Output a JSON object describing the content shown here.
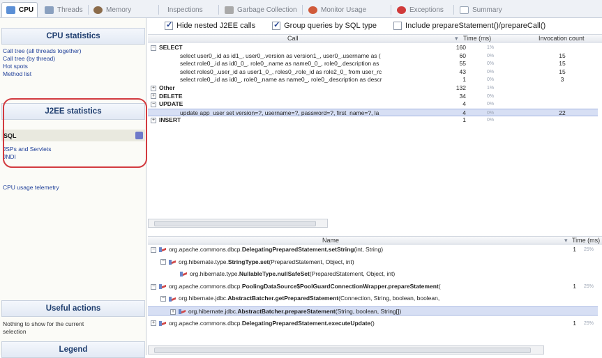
{
  "tabs": [
    {
      "label": "CPU",
      "active": true,
      "icon": "cpu-icon",
      "color": "#5b8fd6"
    },
    {
      "label": "Threads",
      "active": false,
      "icon": "threads-icon",
      "color": "#8aa0bf"
    },
    {
      "label": "Memory",
      "active": false,
      "icon": "memory-icon",
      "color": "#8b6b4a"
    },
    {
      "label": "Inspections",
      "active": false,
      "icon": "",
      "color": ""
    },
    {
      "label": "Garbage Collection",
      "active": false,
      "icon": "garbage-collection-icon",
      "color": "#a9a9a9"
    },
    {
      "label": "Monitor Usage",
      "active": false,
      "icon": "monitor-usage-icon",
      "color": "#d05a3a"
    },
    {
      "label": "Exceptions",
      "active": false,
      "icon": "exceptions-icon",
      "color": "#d03a3a"
    },
    {
      "label": "Summary",
      "active": false,
      "icon": "summary-icon",
      "color": "#9aa6b6"
    }
  ],
  "sidebar": {
    "cpu_header": "CPU statistics",
    "cpu_links": [
      "Call tree (all threads together)",
      "Call tree (by thread)",
      "Hot spots",
      "Method list"
    ],
    "j2ee_header": "J2EE statistics",
    "sql_label": "SQL",
    "j2ee_links": [
      "JSPs and Servlets",
      "JNDI"
    ],
    "telemetry_link": "CPU usage telemetry",
    "useful_header": "Useful actions",
    "useful_note": "Nothing to show for the current selection",
    "legend_header": "Legend"
  },
  "options": [
    {
      "label": "Hide nested J2EE calls",
      "checked": true
    },
    {
      "label": "Group queries by SQL type",
      "checked": true
    },
    {
      "label": "Include prepareStatement()/prepareCall()",
      "checked": false
    }
  ],
  "upper_table": {
    "columns": {
      "call": "Call",
      "time": "Time (ms)",
      "invocation": "Invocation count"
    },
    "rows": [
      {
        "level": 0,
        "expander": "−",
        "text": "SELECT",
        "time": "160",
        "pct": "1%",
        "count": "",
        "selected": false
      },
      {
        "level": 1,
        "expander": "",
        "text": "select user0_.id as id1_, user0_.version as version1_, user0_.username as (",
        "time": "60",
        "pct": "0%",
        "count": "15",
        "selected": false
      },
      {
        "level": 1,
        "expander": "",
        "text": "select role0_.id as id0_0_, role0_.name as name0_0_, role0_.description as",
        "time": "55",
        "pct": "0%",
        "count": "15",
        "selected": false
      },
      {
        "level": 1,
        "expander": "",
        "text": "select roles0_.user_id as user1_0_, roles0_.role_id as role2_0_ from user_rc",
        "time": "43",
        "pct": "0%",
        "count": "15",
        "selected": false
      },
      {
        "level": 1,
        "expander": "",
        "text": "select role0_.id as id0_, role0_.name as name0_, role0_.description as descr",
        "time": "1",
        "pct": "0%",
        "count": "3",
        "selected": false
      },
      {
        "level": 0,
        "expander": "+",
        "text": "Other",
        "time": "132",
        "pct": "1%",
        "count": "",
        "selected": false
      },
      {
        "level": 0,
        "expander": "+",
        "text": "DELETE",
        "time": "34",
        "pct": "0%",
        "count": "",
        "selected": false
      },
      {
        "level": 0,
        "expander": "−",
        "text": "UPDATE",
        "time": "4",
        "pct": "0%",
        "count": "",
        "selected": false
      },
      {
        "level": 1,
        "expander": "",
        "text": "update app_user set version=?, username=?, password=?, first_name=?, la",
        "time": "4",
        "pct": "0%",
        "count": "22",
        "selected": true
      },
      {
        "level": 0,
        "expander": "+",
        "text": "INSERT",
        "time": "1",
        "pct": "0%",
        "count": "",
        "selected": false
      }
    ]
  },
  "lower_table": {
    "columns": {
      "name": "Name",
      "time": "Time (ms)"
    },
    "rows": [
      {
        "level": 0,
        "expander": "−",
        "pre": "org.apache.commons.dbcp.",
        "bold": "DelegatingPreparedStatement.setString",
        "post": "(int, String)",
        "time": "1",
        "pct": "25%",
        "selected": false
      },
      {
        "level": 1,
        "expander": "−",
        "pre": "org.hibernate.type.",
        "bold": "StringType.set",
        "post": "(PreparedStatement, Object, int)",
        "time": "",
        "pct": "",
        "selected": false
      },
      {
        "level": 2,
        "expander": "",
        "pre": "org.hibernate.type.",
        "bold": "NullableType.nullSafeSet",
        "post": "(PreparedStatement, Object, int)",
        "time": "",
        "pct": "",
        "selected": false
      },
      {
        "level": 0,
        "expander": "−",
        "pre": "org.apache.commons.dbcp.",
        "bold": "PoolingDataSource$PoolGuardConnectionWrapper.prepareStatement",
        "post": "(",
        "time": "1",
        "pct": "25%",
        "selected": false
      },
      {
        "level": 1,
        "expander": "−",
        "pre": "org.hibernate.jdbc.",
        "bold": "AbstractBatcher.getPreparedStatement",
        "post": "(Connection, String, boolean, boolean,",
        "time": "",
        "pct": "",
        "selected": false
      },
      {
        "level": 2,
        "expander": "+",
        "pre": "org.hibernate.jdbc.",
        "bold": "AbstractBatcher.prepareStatement",
        "post": "(String, boolean, String[])",
        "time": "",
        "pct": "",
        "selected": true
      },
      {
        "level": 0,
        "expander": "+",
        "pre": "org.apache.commons.dbcp.",
        "bold": "DelegatingPreparedStatement.executeUpdate",
        "post": "()",
        "time": "1",
        "pct": "25%",
        "selected": false
      }
    ]
  },
  "colors": {
    "accent": "#1f3e6f",
    "link": "#20409a",
    "selection": "#d7dff4",
    "highlight_ring": "#d23a3f"
  }
}
